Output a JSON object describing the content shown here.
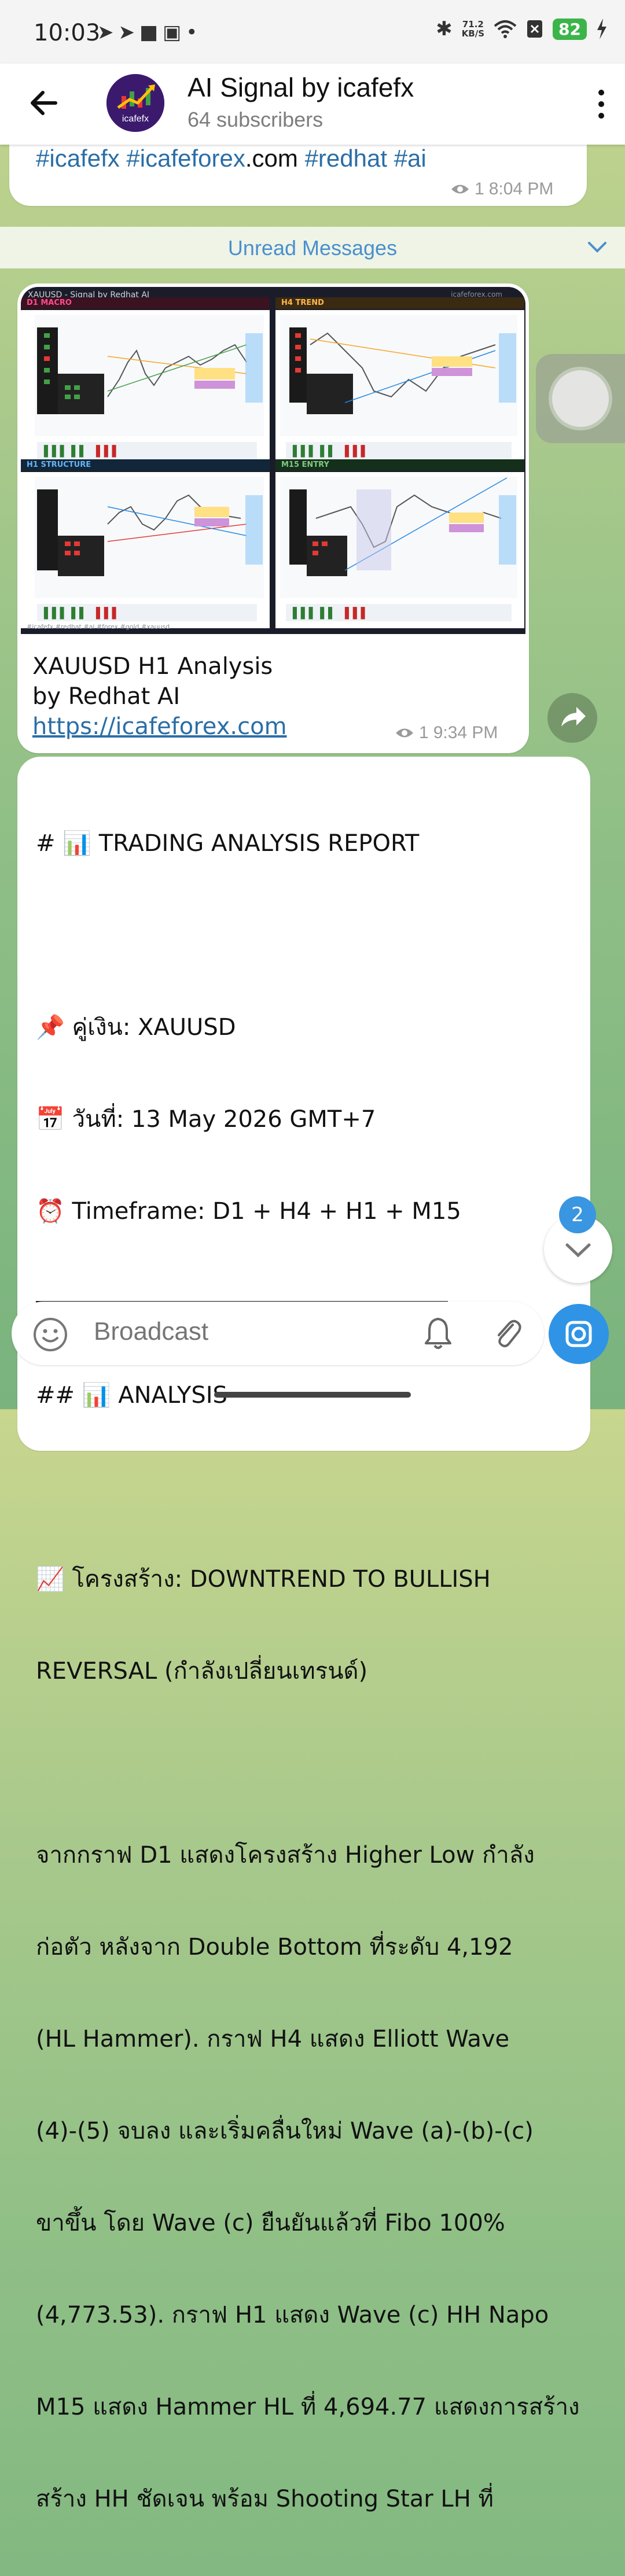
{
  "status_bar": {
    "time": "10:03",
    "net_speed_value": "71.2",
    "net_speed_unit": "KB/S",
    "battery": "82",
    "left_icons": [
      "send-icon",
      "send-icon",
      "app-icon",
      "parking-icon",
      "dot-icon"
    ],
    "right_icons": [
      "bluetooth-icon",
      "wifi-icon",
      "no-sim-icon",
      "charging-icon"
    ]
  },
  "header": {
    "title": "AI Signal by icafefx",
    "subtitle": "64 subscribers",
    "avatar_text": "icafefx"
  },
  "messages": {
    "previous": {
      "tag1": "#icafefx",
      "tag2": "#icafeforex",
      "tag2_suffix": ".com",
      "tag3": "#redhat",
      "tag4": "#ai",
      "views": "1",
      "time": "8:04 PM"
    },
    "unread_label": "Unread Messages",
    "image_post": {
      "image_header": "XAUUSD - Signal by Redhat AI",
      "image_header_right": "icafeforex.com",
      "panels": [
        {
          "title": "D1 MACRO",
          "color": "#c2185b"
        },
        {
          "title": "H4 TREND",
          "color": "#f5a623"
        },
        {
          "title": "H1 STRUCTURE",
          "color": "#1e88e5"
        },
        {
          "title": "M15 ENTRY",
          "color": "#43a047"
        }
      ],
      "image_footer": "#icafefx #redhat #ai #forex #gold #xauusd",
      "caption_line1": "XAUUSD H1 Analysis",
      "caption_line2": "by Redhat AI",
      "link": "https://icafeforex.com",
      "views": "1",
      "time": "9:34 PM"
    },
    "report": {
      "title": "# 📊 TRADING ANALYSIS REPORT",
      "pair": "📌 คู่เงิน: XAUUSD",
      "date": "📅 วันที่: 13 May 2026 GMT+7",
      "timeframe": "⏰ Timeframe: D1 + H4 + H1 + M15",
      "analysis_heading": "## 📊 ANALYSIS",
      "structure_1": "📈 โครงสร้าง: DOWNTREND TO BULLISH",
      "structure_2": "REVERSAL (กำลังเปลี่ยนเทรนด์)",
      "p1": "จากกราฟ D1 แสดงโครงสร้าง Higher Low กำลัง",
      "p2": "ก่อตัว หลังจาก Double Bottom ที่ระดับ 4,192",
      "p3": "(HL Hammer). กราฟ H4 แสดง Elliott Wave",
      "p4": "(4)-(5) จบลง และเริ่มคลื่นใหม่ Wave (a)-(b)-(c)",
      "p5": "ขาขึ้น โดย Wave (c) ยืนยันแล้วที่ Fibo 100%",
      "p6": "(4,773.53). กราฟ H1 แสดง Wave (c) HH Napo",
      "p7": "M15 แสดง Hammer HL ที่ 4,694.77 แสดงการสร้าง",
      "p8": "สร้าง HH ชัดเจน พร้อม Shooting Star LH ที่"
    }
  },
  "scroll": {
    "unread_count": "2"
  },
  "composer": {
    "placeholder": "Broadcast"
  },
  "colors": {
    "link": "#2b6ea6",
    "unread": "#4a8fce",
    "accent": "#2f94e5",
    "battery": "#3bb54a"
  }
}
